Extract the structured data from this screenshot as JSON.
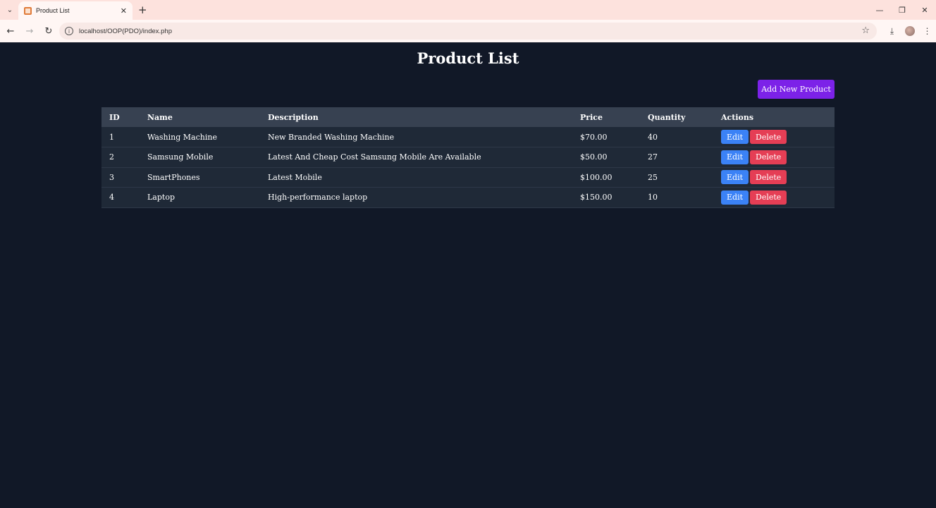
{
  "browser": {
    "tab_title": "Product List",
    "url": "localhost/OOP(PDO)/index.php"
  },
  "page": {
    "title": "Product List",
    "add_button": "Add New Product",
    "headers": [
      "ID",
      "Name",
      "Description",
      "Price",
      "Quantity",
      "Actions"
    ],
    "rows": [
      {
        "id": "1",
        "name": "Washing Machine",
        "description": "New Branded Washing Machine",
        "price": "$70.00",
        "quantity": "40"
      },
      {
        "id": "2",
        "name": "Samsung Mobile",
        "description": "Latest And Cheap Cost Samsung Mobile Are Available",
        "price": "$50.00",
        "quantity": "27"
      },
      {
        "id": "3",
        "name": "SmartPhones",
        "description": "Latest Mobile",
        "price": "$100.00",
        "quantity": "25"
      },
      {
        "id": "4",
        "name": "Laptop",
        "description": "High-performance laptop",
        "price": "$150.00",
        "quantity": "10"
      }
    ],
    "edit_label": "Edit",
    "delete_label": "Delete"
  },
  "colors": {
    "background": "#111827",
    "header_row": "#374151",
    "body_row": "#1f2937",
    "add_button": "#7c22e8",
    "edit_button": "#3b82f6",
    "delete_button": "#e53e55"
  }
}
